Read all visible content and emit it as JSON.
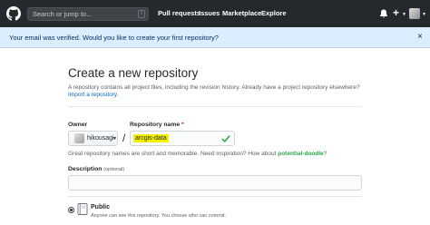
{
  "header": {
    "search_placeholder": "Search or jump to...",
    "search_key": "/",
    "nav": [
      "Pull requests",
      "Issues",
      "Marketplace",
      "Explore"
    ],
    "icons": [
      "github-logo",
      "bell-icon",
      "plus-icon",
      "avatar"
    ]
  },
  "flash": {
    "message": "Your email was verified. Would you like to create your first repository?",
    "close": "×"
  },
  "form": {
    "title": "Create a new repository",
    "subtitle": "A repository contains all project files, including the revision history. Already have a project repository elsewhere?",
    "import_link": "Import a repository.",
    "owner_label": "Owner",
    "owner_value": "hikousagi",
    "repo_label": "Repository name",
    "required_mark": "*",
    "separator": "/",
    "repo_value": "arcgis-data",
    "hint_text": "Great repository names are short and memorable. Need inspiration? How about ",
    "hint_suggestion": "potential-doodle",
    "hint_end": "?",
    "description_label": "Description",
    "description_optional": "(optional)",
    "description_value": "",
    "visibility": {
      "selected": "public",
      "public_label": "Public",
      "public_desc": "Anyone can see this repository. You choose who can commit."
    }
  },
  "colors": {
    "header_bg": "#24292e",
    "flash_bg": "#dbedff",
    "link": "#0366d6",
    "success": "#28a745",
    "highlight": "#f5f000"
  }
}
